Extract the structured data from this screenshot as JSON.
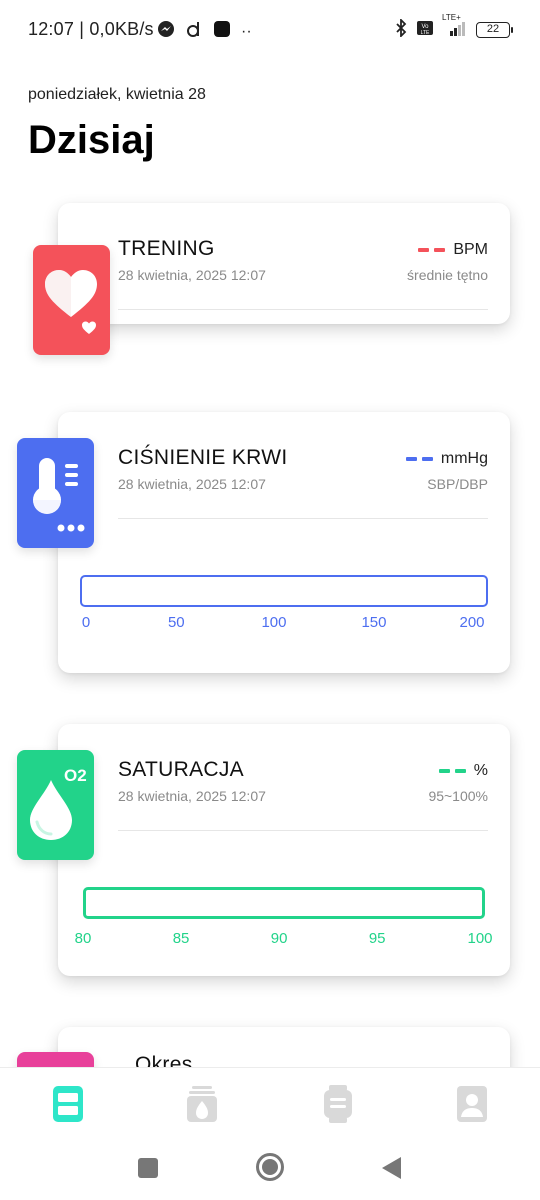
{
  "status_bar": {
    "time_speed": "12:07 | 0,0KB/s",
    "battery": "22",
    "network": "LTE+"
  },
  "header": {
    "date": "poniedziałek, kwietnia 28",
    "title": "Dzisiaj"
  },
  "cards": {
    "training": {
      "title": "TRENING",
      "timestamp": "28 kwietnia, 2025 12:07",
      "value_placeholder": "--",
      "unit": "BPM",
      "subtitle": "średnie tętno",
      "accent": "#f4525a"
    },
    "blood_pressure": {
      "title": "CIŚNIENIE KRWI",
      "timestamp": "28 kwietnia, 2025 12:07",
      "value_placeholder": "--",
      "unit": "mmHg",
      "subtitle": "SBP/DBP",
      "accent": "#4d6ef0",
      "scale": [
        "0",
        "50",
        "100",
        "150",
        "200"
      ]
    },
    "saturation": {
      "title": "SATURACJA",
      "timestamp": "28 kwietnia, 2025 12:07",
      "value_placeholder": "--",
      "unit": "%",
      "subtitle": "95~100%",
      "accent": "#22d38a",
      "badge": "O2",
      "scale": [
        "80",
        "85",
        "90",
        "95",
        "100"
      ]
    },
    "period": {
      "title": "Okres",
      "accent": "#e8409a"
    }
  },
  "bottom_nav": {
    "items": [
      {
        "icon": "dashboard-icon",
        "active": true
      },
      {
        "icon": "workout-fire-icon",
        "active": false
      },
      {
        "icon": "watch-icon",
        "active": false
      },
      {
        "icon": "profile-icon",
        "active": false
      }
    ],
    "active_color": "#2ee6c9"
  }
}
